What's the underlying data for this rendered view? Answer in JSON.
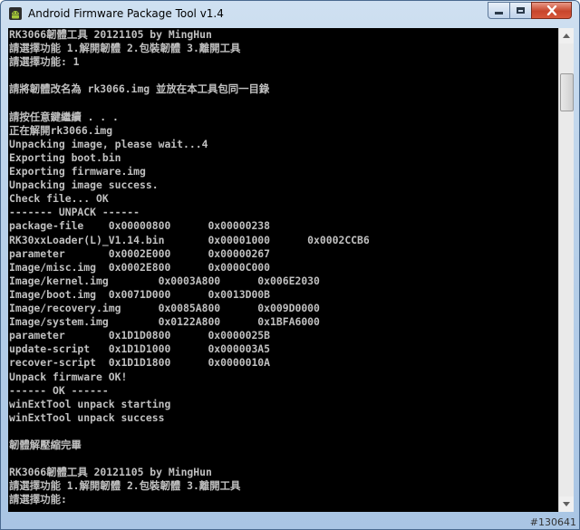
{
  "window": {
    "title": "Android Firmware Package Tool v1.4",
    "icons": {
      "app": "android-app-icon",
      "minimize": "minimize-icon",
      "maximize": "maximize-icon",
      "close": "close-icon"
    }
  },
  "console": {
    "lines": [
      "RK3066韌體工具 20121105 by MingHun",
      "請選擇功能 1.解開韌體 2.包裝韌體 3.離開工具",
      "請選擇功能: 1",
      "",
      "請將韌體改名為 rk3066.img 並放在本工具包同一目錄",
      "",
      "請按任意鍵繼續 . . .",
      "正在解開rk3066.img",
      "Unpacking image, please wait...4",
      "Exporting boot.bin",
      "Exporting firmware.img",
      "Unpacking image success.",
      "Check file... OK",
      "------- UNPACK ------",
      "package-file    0x00000800      0x00000238",
      "RK30xxLoader(L)_V1.14.bin       0x00001000      0x0002CCB6",
      "parameter       0x0002E000      0x00000267",
      "Image/misc.img  0x0002E800      0x0000C000",
      "Image/kernel.img        0x0003A800      0x006E2030",
      "Image/boot.img  0x0071D000      0x0013D00B",
      "Image/recovery.img      0x0085A800      0x009D0000",
      "Image/system.img        0x0122A800      0x1BFA6000",
      "parameter       0x1D1D0800      0x0000025B",
      "update-script   0x1D1D1000      0x000003A5",
      "recover-script  0x1D1D1800      0x0000010A",
      "Unpack firmware OK!",
      "------ OK ------",
      "winExtTool unpack starting",
      "winExtTool unpack success",
      "",
      "韌體解壓縮完畢",
      "",
      "RK3066韌體工具 20121105 by MingHun",
      "請選擇功能 1.解開韌體 2.包裝韌體 3.離開工具",
      "請選擇功能:"
    ]
  },
  "watermark": "#130641"
}
